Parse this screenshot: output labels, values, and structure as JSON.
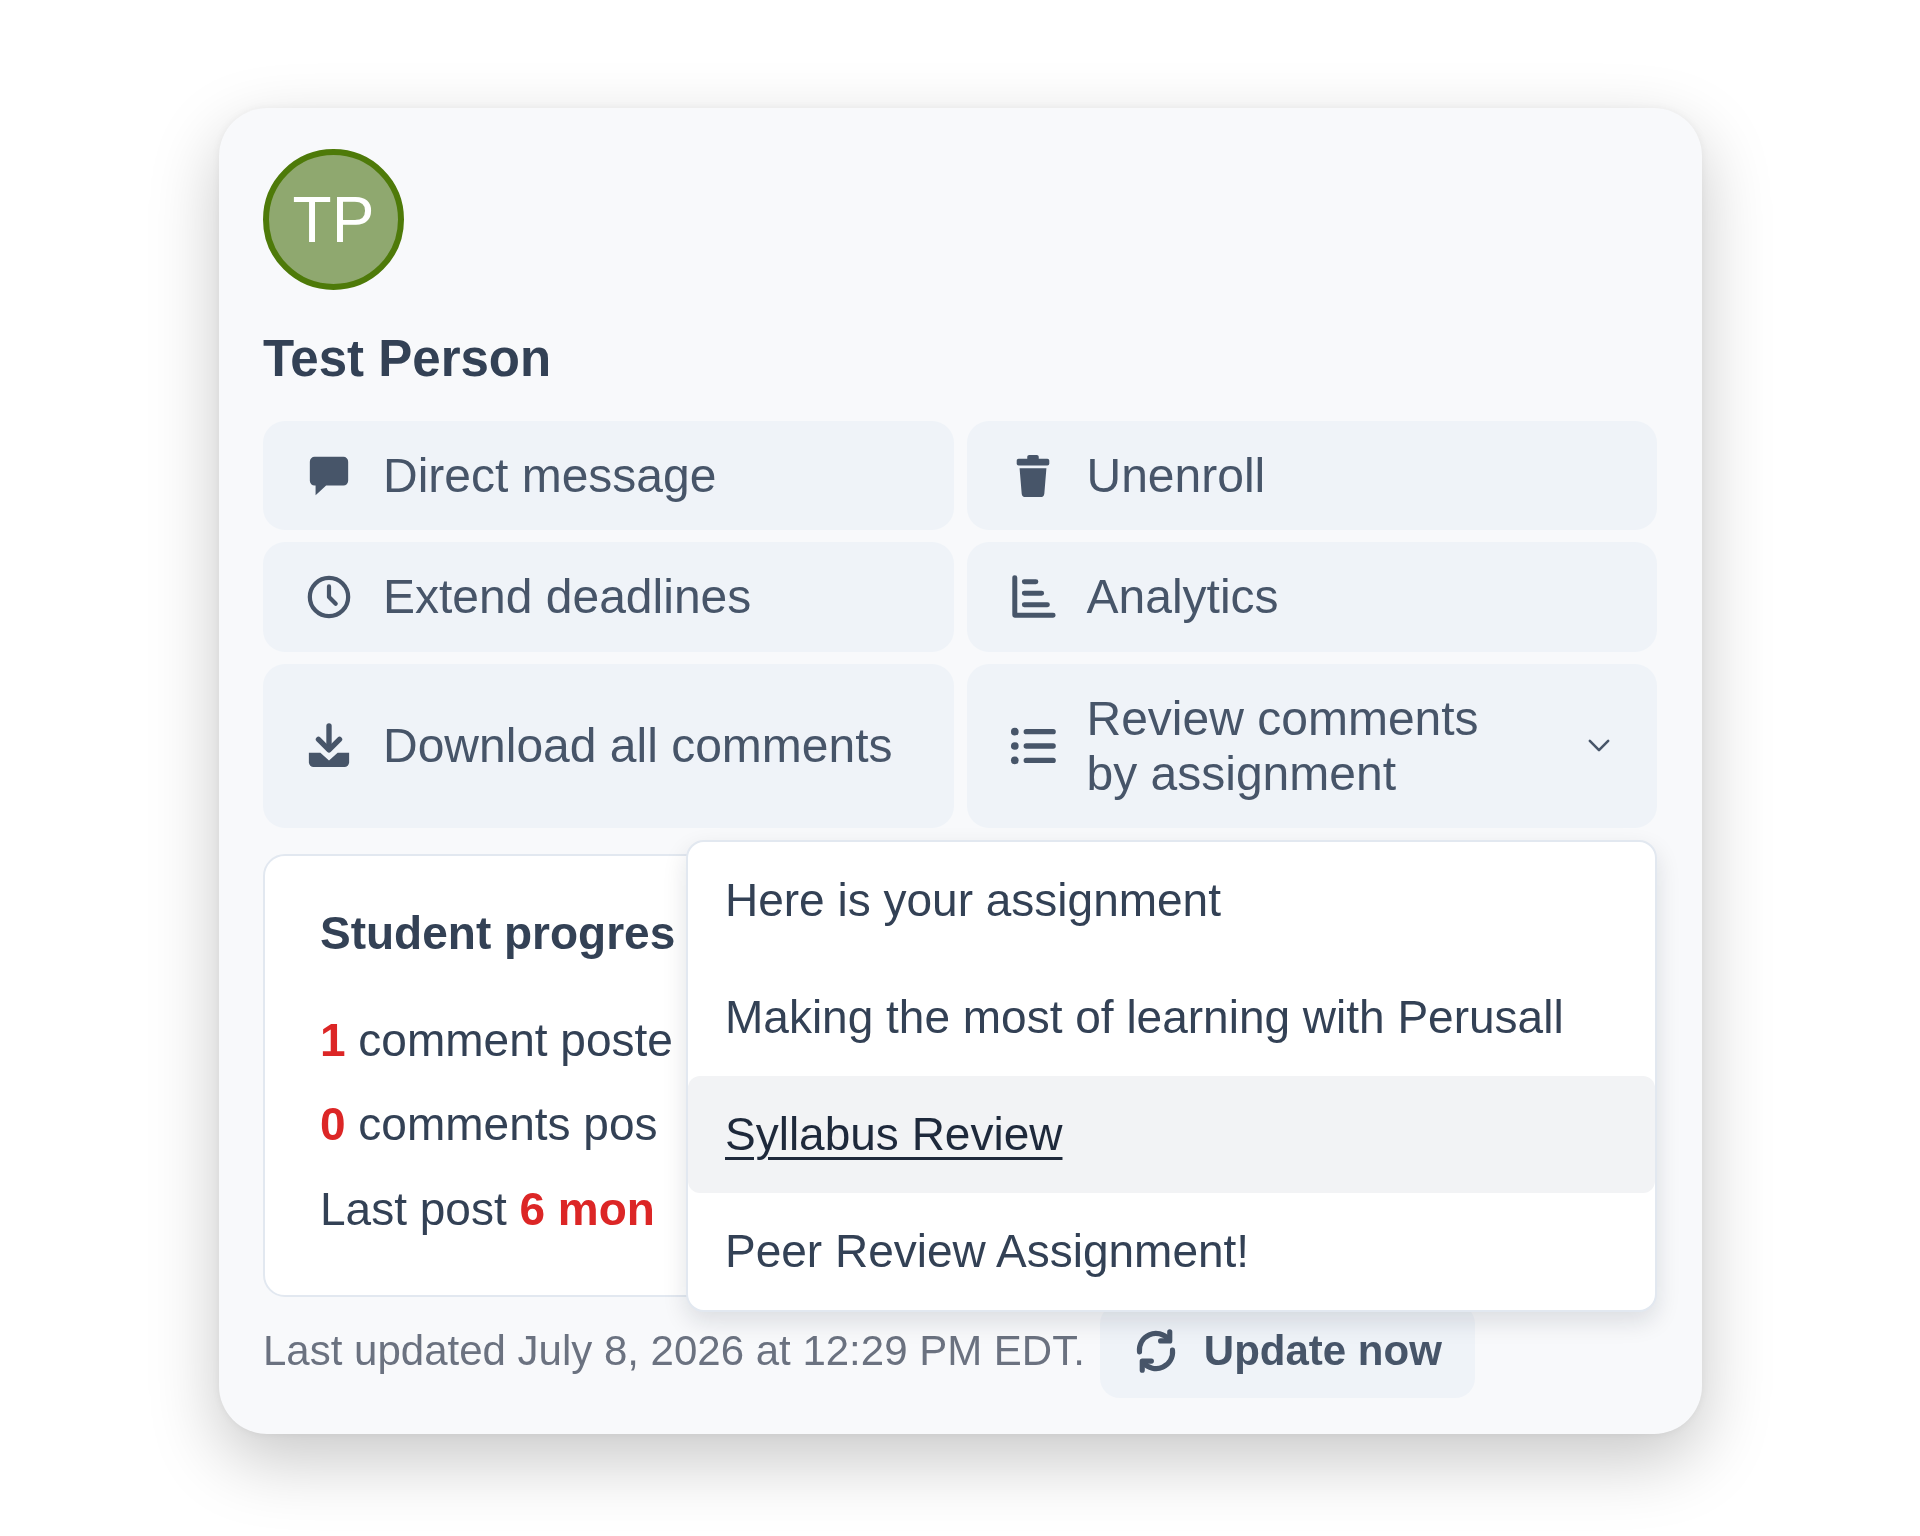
{
  "profile": {
    "initials": "TP",
    "name": "Test Person"
  },
  "actions": [
    {
      "kind": "button",
      "label": "Direct message"
    },
    {
      "kind": "button",
      "label": "Unenroll"
    },
    {
      "kind": "button",
      "label": "Extend deadlines"
    },
    {
      "kind": "button",
      "label": "Analytics"
    },
    {
      "kind": "button",
      "label": "Download all comments"
    },
    {
      "kind": "dropdown",
      "label": "Review comments by assignment",
      "expanded": true,
      "menu": [
        {
          "label": "Here is your assignment",
          "selected": false
        },
        {
          "label": "Making the most of learning with Perusall",
          "selected": false
        },
        {
          "label": "Syllabus Review",
          "selected": true
        },
        {
          "label": "Peer Review Assignment!",
          "selected": false
        }
      ]
    }
  ],
  "progress": {
    "title": "Student progres",
    "stats": [
      "**1** comment poste",
      "**0** comments pos",
      "Last post **6 mon**"
    ]
  },
  "footer": {
    "last_updated": "Last updated July 8, 2026 at 12:29 PM EDT.",
    "update_button": "Update now"
  }
}
